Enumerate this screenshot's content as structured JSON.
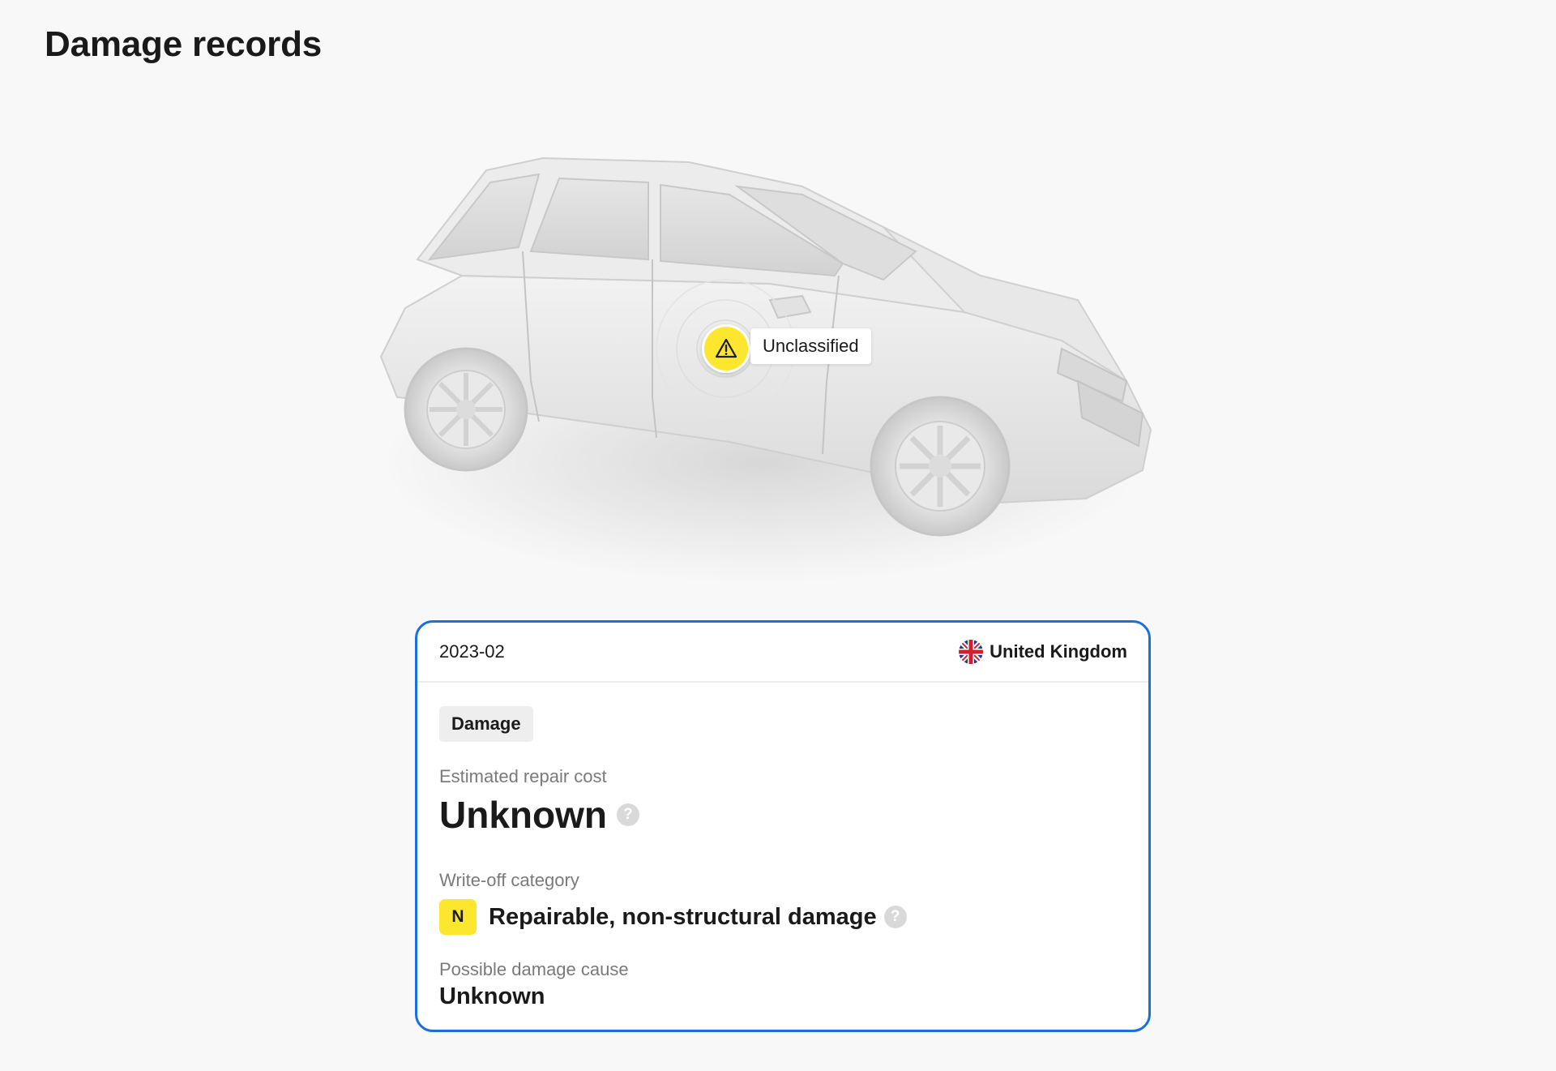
{
  "page": {
    "title": "Damage records"
  },
  "vehicle_view": {
    "marker": {
      "icon": "warning-icon",
      "label": "Unclassified",
      "color": "#fde72e"
    }
  },
  "record": {
    "date": "2023-02",
    "country": {
      "flag_icon": "uk-flag-icon",
      "name": "United Kingdom"
    },
    "type_tag": "Damage",
    "repair_cost": {
      "label": "Estimated repair cost",
      "value": "Unknown",
      "help_icon": "question-icon",
      "help_symbol": "?"
    },
    "write_off": {
      "label": "Write-off category",
      "badge": "N",
      "badge_color": "#fde72e",
      "value": "Repairable, non-structural damage",
      "help_icon": "question-icon",
      "help_symbol": "?"
    },
    "damage_cause": {
      "label": "Possible damage cause",
      "value": "Unknown"
    },
    "border_color": "#1a6fe0"
  }
}
